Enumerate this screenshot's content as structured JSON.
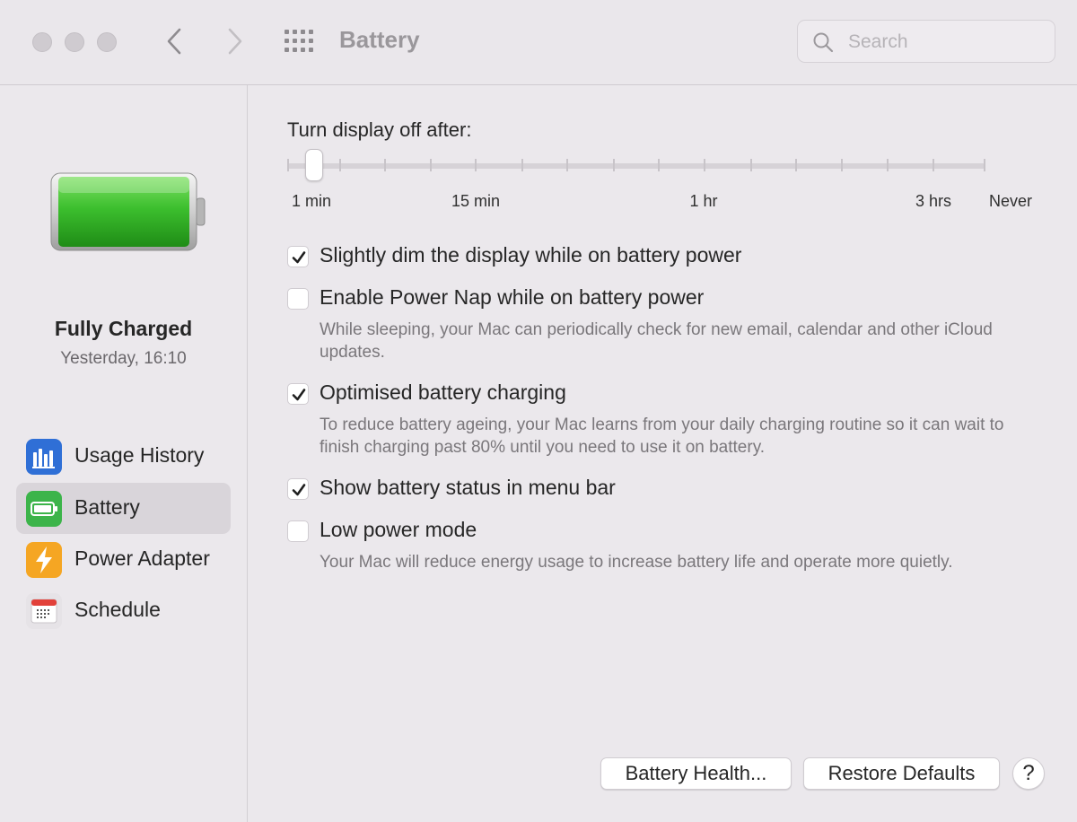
{
  "window": {
    "title": "Battery",
    "search_placeholder": "Search"
  },
  "sidebar": {
    "status_title": "Fully Charged",
    "status_time": "Yesterday, 16:10",
    "battery_level": 1.0,
    "items": [
      {
        "label": "Usage History",
        "icon": "bar-chart-icon",
        "selected": false
      },
      {
        "label": "Battery",
        "icon": "battery-icon",
        "selected": true
      },
      {
        "label": "Power Adapter",
        "icon": "lightning-bolt-icon",
        "selected": false
      },
      {
        "label": "Schedule",
        "icon": "calendar-icon",
        "selected": false
      }
    ]
  },
  "main": {
    "slider": {
      "title": "Turn display off after:",
      "value": "1 min",
      "labels": [
        "1 min",
        "15 min",
        "1 hr",
        "3 hrs",
        "Never"
      ]
    },
    "options": [
      {
        "label": "Slightly dim the display while on battery power",
        "checked": true,
        "description": ""
      },
      {
        "label": "Enable Power Nap while on battery power",
        "checked": false,
        "description": "While sleeping, your Mac can periodically check for new email, calendar and other iCloud updates."
      },
      {
        "label": "Optimised battery charging",
        "checked": true,
        "description": "To reduce battery ageing, your Mac learns from your daily charging routine so it can wait to finish charging past 80% until you need to use it on battery."
      },
      {
        "label": "Show battery status in menu bar",
        "checked": true,
        "description": ""
      },
      {
        "label": "Low power mode",
        "checked": false,
        "description": "Your Mac will reduce energy usage to increase battery life and operate more quietly."
      }
    ],
    "buttons": {
      "battery_health": "Battery Health...",
      "restore_defaults": "Restore Defaults",
      "help": "?"
    }
  },
  "colors": {
    "accent_green": "#3cbf2e",
    "window_bg": "#ebe8ec",
    "selected_bg": "#d9d5da"
  }
}
